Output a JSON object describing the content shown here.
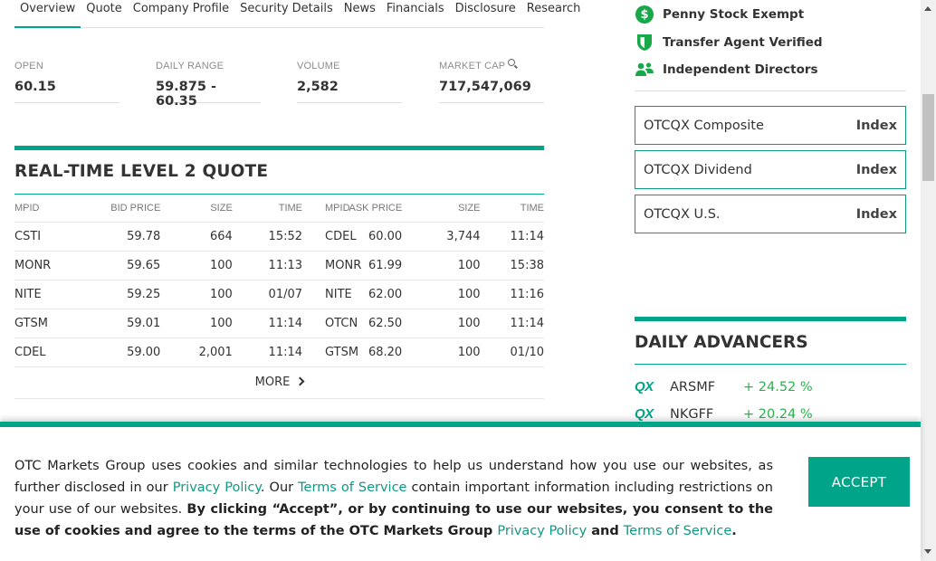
{
  "tabs": [
    "Overview",
    "Quote",
    "Company Profile",
    "Security Details",
    "News",
    "Financials",
    "Disclosure",
    "Research"
  ],
  "stats": {
    "open": {
      "label": "OPEN",
      "value": "60.15"
    },
    "daily_range": {
      "label": "DAILY RANGE",
      "value": "59.875 - 60.35"
    },
    "volume": {
      "label": "VOLUME",
      "value": "2,582"
    },
    "market_cap": {
      "label": "MARKET CAP",
      "value": "717,547,069"
    }
  },
  "level2": {
    "title": "REAL-TIME LEVEL 2 QUOTE",
    "headers": [
      "MPID",
      "BID PRICE",
      "SIZE",
      "TIME",
      "MPID",
      "ASK PRICE",
      "SIZE",
      "TIME"
    ],
    "rows": [
      [
        "CSTI",
        "59.78",
        "664",
        "15:52",
        "CDEL",
        "60.00",
        "3,744",
        "11:14"
      ],
      [
        "MONR",
        "59.65",
        "100",
        "11:13",
        "MONR",
        "61.99",
        "100",
        "15:38"
      ],
      [
        "NITE",
        "59.25",
        "100",
        "01/07",
        "NITE",
        "62.00",
        "100",
        "11:16"
      ],
      [
        "GTSM",
        "59.01",
        "100",
        "11:14",
        "OTCN",
        "62.50",
        "100",
        "11:14"
      ],
      [
        "CDEL",
        "59.00",
        "2,001",
        "11:14",
        "GTSM",
        "68.20",
        "100",
        "01/10"
      ]
    ],
    "more_label": "MORE"
  },
  "badges": [
    {
      "label": "Penny Stock Exempt",
      "icon": "dollar-circle-icon"
    },
    {
      "label": "Transfer Agent Verified",
      "icon": "shield-icon"
    },
    {
      "label": "Independent Directors",
      "icon": "people-icon"
    }
  ],
  "indices": [
    {
      "name": "OTCQX Composite",
      "tag": "Index"
    },
    {
      "name": "OTCQX Dividend",
      "tag": "Index"
    },
    {
      "name": "OTCQX U.S.",
      "tag": "Index"
    }
  ],
  "advancers": {
    "title": "DAILY ADVANCERS",
    "items": [
      {
        "market": "QX",
        "symbol": "ARSMF",
        "change": "+ 24.52 %"
      },
      {
        "market": "QX",
        "symbol": "NKGFF",
        "change": "+ 20.24 %"
      }
    ]
  },
  "cookie": {
    "t1": "OTC Markets Group uses cookies and similar technologies to help us understand how you use our websites, as further disclosed in our ",
    "link1": "Privacy Policy",
    "t2": ". Our ",
    "link2": "Terms of Service",
    "t3": " contain important information including restrictions on your use of our websites. ",
    "bold1": "By clicking “Accept”, or by continuing to use our websites, you consent to the use of cookies and agree to the terms of the OTC Markets Group ",
    "link3": "Privacy Policy",
    "bold2": " and ",
    "link4": "Terms of Service",
    "bold3": ".",
    "accept_label": "ACCEPT"
  },
  "colors": {
    "accent": "#00a488",
    "positive": "#2bb24c",
    "badge_green": "#18a84a"
  }
}
